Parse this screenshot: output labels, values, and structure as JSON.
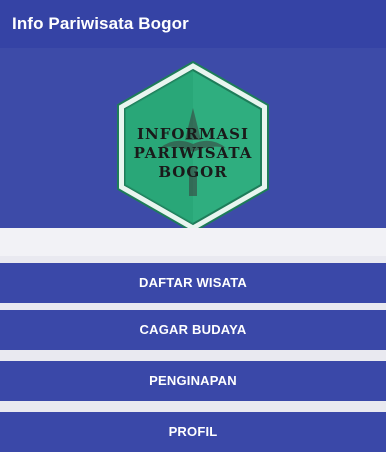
{
  "app": {
    "title": "Info Pariwisata Bogor"
  },
  "logo": {
    "line1": "INFORMASI",
    "line2": "PARIWISATA",
    "line3": "BOGOR",
    "colors": {
      "hex_fill": "#2fae7f",
      "hex_border": "#e8f5ef",
      "hex_outline": "#1e7c59"
    }
  },
  "menu": {
    "items": [
      {
        "label": "DAFTAR WISATA"
      },
      {
        "label": "CAGAR BUDAYA"
      },
      {
        "label": "PENGINAPAN"
      },
      {
        "label": "PROFIL"
      }
    ]
  },
  "colors": {
    "primary": "#3543a5",
    "button": "#3a48a8",
    "background": "#e9e9f0"
  }
}
